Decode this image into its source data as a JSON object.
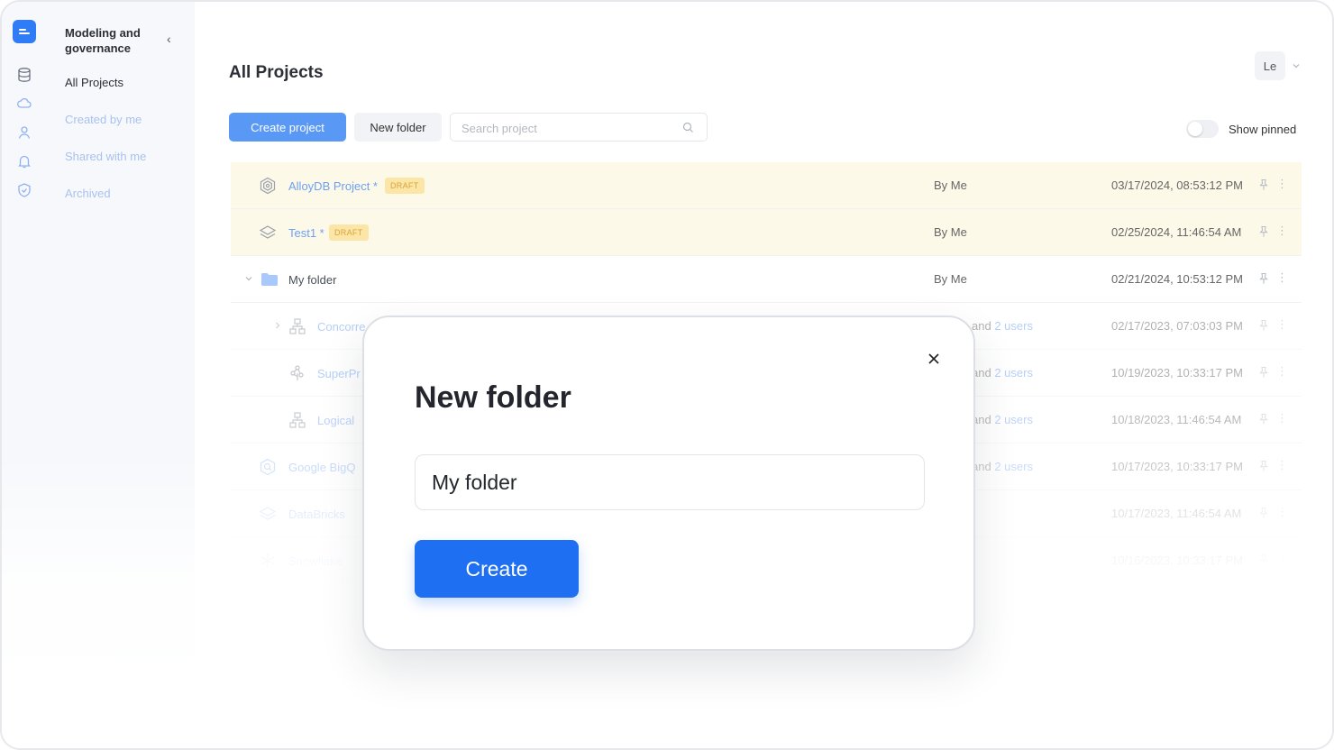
{
  "sidebar": {
    "title": "Modeling and governance",
    "items": [
      {
        "label": "All Projects"
      },
      {
        "label": "Created by me"
      },
      {
        "label": "Shared with me"
      },
      {
        "label": "Archived"
      }
    ]
  },
  "header": {
    "title": "All Projects",
    "avatar": "Le"
  },
  "toolbar": {
    "create_project": "Create project",
    "new_folder": "New folder",
    "search_placeholder": "Search project",
    "show_pinned": "Show pinned"
  },
  "rows": [
    {
      "name": "AlloyDB Project *",
      "badge": "DRAFT",
      "owner": "By Me",
      "date": "03/17/2024, 08:53:12 PM"
    },
    {
      "name": "Test1 *",
      "badge": "DRAFT",
      "owner": "By Me",
      "date": "02/25/2024, 11:46:54 AM"
    },
    {
      "name": "My folder",
      "owner": "By Me",
      "date": "02/21/2024, 10:53:12 PM"
    },
    {
      "name": "Concorre",
      "owner_text": "and",
      "users": "2 users",
      "date": "02/17/2023, 07:03:03 PM"
    },
    {
      "name": "SuperPr",
      "owner_text": "and",
      "users": "2 users",
      "date": "10/19/2023, 10:33:17 PM"
    },
    {
      "name": "Logical",
      "owner_text": "and",
      "users": "2 users",
      "date": "10/18/2023, 11:46:54 AM"
    },
    {
      "name": "Google BigQ",
      "owner_text": "and",
      "users": "2 users",
      "date": "10/17/2023, 10:33:17 PM"
    },
    {
      "name": "DataBricks",
      "date": "10/17/2023, 11:46:54 AM"
    },
    {
      "name": "Snowflake",
      "date": "10/16/2023, 10:33:17 PM"
    }
  ],
  "modal": {
    "title": "New folder",
    "input_value": "My folder",
    "create": "Create"
  },
  "colors": {
    "accent": "#1f6ff2",
    "highlight_row": "#fdf9e9",
    "badge": "#fbe6a8"
  }
}
